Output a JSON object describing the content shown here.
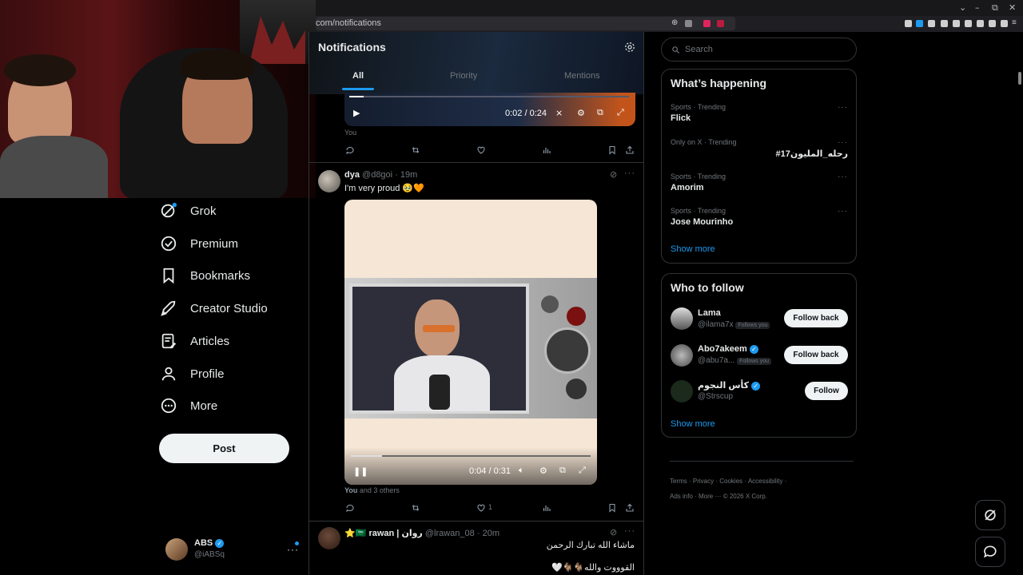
{
  "browser": {
    "url": "com/notifications"
  },
  "nav": {
    "items": [
      {
        "key": "grok",
        "label": "Grok",
        "icon": "grok-icon"
      },
      {
        "key": "premium",
        "label": "Premium",
        "icon": "premium-icon"
      },
      {
        "key": "bookmarks",
        "label": "Bookmarks",
        "icon": "bookmark-icon"
      },
      {
        "key": "creator-studio",
        "label": "Creator Studio",
        "icon": "rocket-icon"
      },
      {
        "key": "articles",
        "label": "Articles",
        "icon": "article-icon"
      },
      {
        "key": "profile",
        "label": "Profile",
        "icon": "person-icon"
      },
      {
        "key": "more",
        "label": "More",
        "icon": "more-circle-icon"
      }
    ],
    "post_label": "Post",
    "account": {
      "name": "ABS",
      "handle": "@iABSq"
    }
  },
  "notifications": {
    "title": "Notifications",
    "tabs": [
      "All",
      "Priority",
      "Mentions"
    ],
    "active_tab": "All",
    "first_video": {
      "time": "0:02 / 0:24",
      "liked_by": "You",
      "progress": 0.05
    },
    "post1": {
      "name": "dya",
      "handle": "@d8goi",
      "time": "19m",
      "text": "I'm very proud 🥹🧡",
      "video_time": "0:04 / 0:31",
      "video_progress": 0.13,
      "liked_by_you": "You",
      "liked_by_rest": "and 3 others",
      "like_count": "1"
    },
    "post2": {
      "name": "⭐🇸🇦 rawan | روان",
      "handle": "@lrawan_08",
      "time": "20m",
      "line1": "ماشاء الله تبارك الرحمن",
      "line2": "القوووت والله🐐🐐🤍"
    }
  },
  "sidebar": {
    "search_placeholder": "Search",
    "trends_title": "What’s happening",
    "trends": [
      {
        "category": "Sports · Trending",
        "name": "Flick"
      },
      {
        "category": "Only on X · Trending",
        "name": "#رحله_المليون17"
      },
      {
        "category": "Sports · Trending",
        "name": "Amorim"
      },
      {
        "category": "Sports · Trending",
        "name": "Jose Mourinho"
      }
    ],
    "trends_show_more": "Show more",
    "follow_title": "Who to follow",
    "follow": [
      {
        "name": "Lama",
        "handle": "@ilama7x",
        "badge": "Follows you",
        "button": "Follow back",
        "verified": false
      },
      {
        "name": "Abo7akeem",
        "handle": "@abu7a...",
        "badge": "Follows you",
        "button": "Follow back",
        "verified": true
      },
      {
        "name": "كأس النجوم",
        "handle": "@Strscup",
        "badge": "",
        "button": "Follow",
        "verified": true
      }
    ],
    "follow_show_more": "Show more",
    "footer": [
      "Terms",
      "Privacy",
      "Cookies",
      "Accessibility",
      "Ads info",
      "More ···",
      "© 2026 X Corp."
    ]
  },
  "colors": {
    "accent": "#1d9bf0",
    "background": "#000000",
    "border": "#2f3336"
  }
}
